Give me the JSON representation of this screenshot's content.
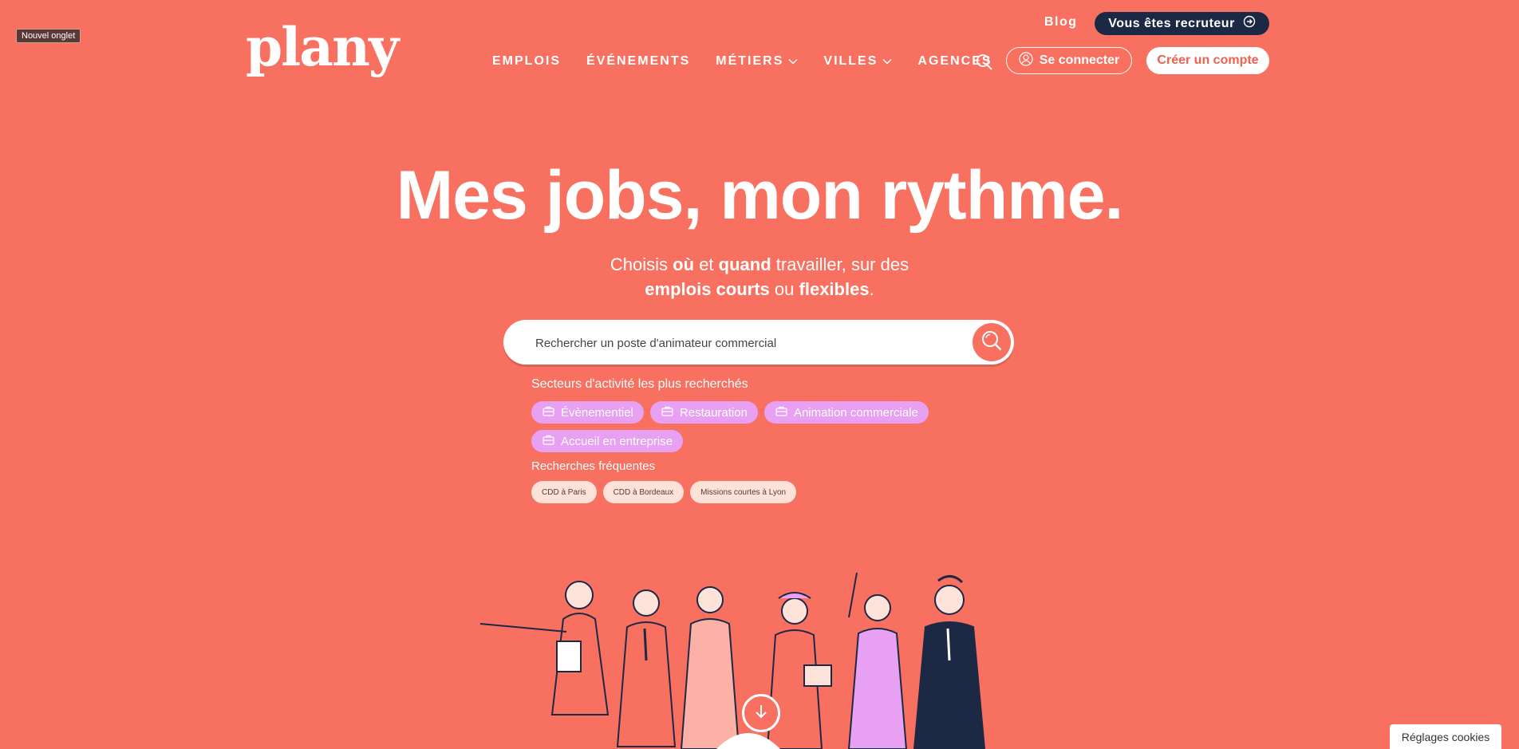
{
  "browser": {
    "tab_badge": "Nouvel onglet"
  },
  "header": {
    "logo": "plany",
    "blog": "Blog",
    "recruiter_button": "Vous êtes recruteur",
    "nav": [
      {
        "label": "EMPLOIS",
        "has_dropdown": false
      },
      {
        "label": "ÉVÉNEMENTS",
        "has_dropdown": false
      },
      {
        "label": "MÉTIERS",
        "has_dropdown": true
      },
      {
        "label": "VILLES",
        "has_dropdown": true
      },
      {
        "label": "AGENCES",
        "has_dropdown": false
      }
    ],
    "login_button": "Se connecter",
    "signup_button": "Créer un compte"
  },
  "hero": {
    "title": "Mes jobs, mon rythme.",
    "subtitle_parts": [
      "Choisis",
      "où",
      "et",
      "quand",
      "travailler, sur des",
      "emplois courts",
      "ou",
      "flexibles",
      "."
    ]
  },
  "search": {
    "placeholder": "Rechercher un poste d'animateur commercial"
  },
  "sectors": {
    "label": "Secteurs d'activité les plus recherchés",
    "items": [
      "Évènementiel",
      "Restauration",
      "Animation commerciale",
      "Accueil en entreprise"
    ]
  },
  "frequent": {
    "label": "Recherches fréquentes",
    "items": [
      "CDD à Paris",
      "CDD à Bordeaux",
      "Missions courtes à Lyon"
    ]
  },
  "cookies_button": "Réglages cookies",
  "colors": {
    "background": "#f87060",
    "recruiter_bg": "#1c2945",
    "chip_bg": "#e7a0f2",
    "freq_chip_bg": "#fde2da"
  },
  "icons": [
    "search-icon",
    "user-icon",
    "arrow-right-circle-icon",
    "chevron-down-icon",
    "briefcase-icon",
    "arrow-down-icon"
  ]
}
